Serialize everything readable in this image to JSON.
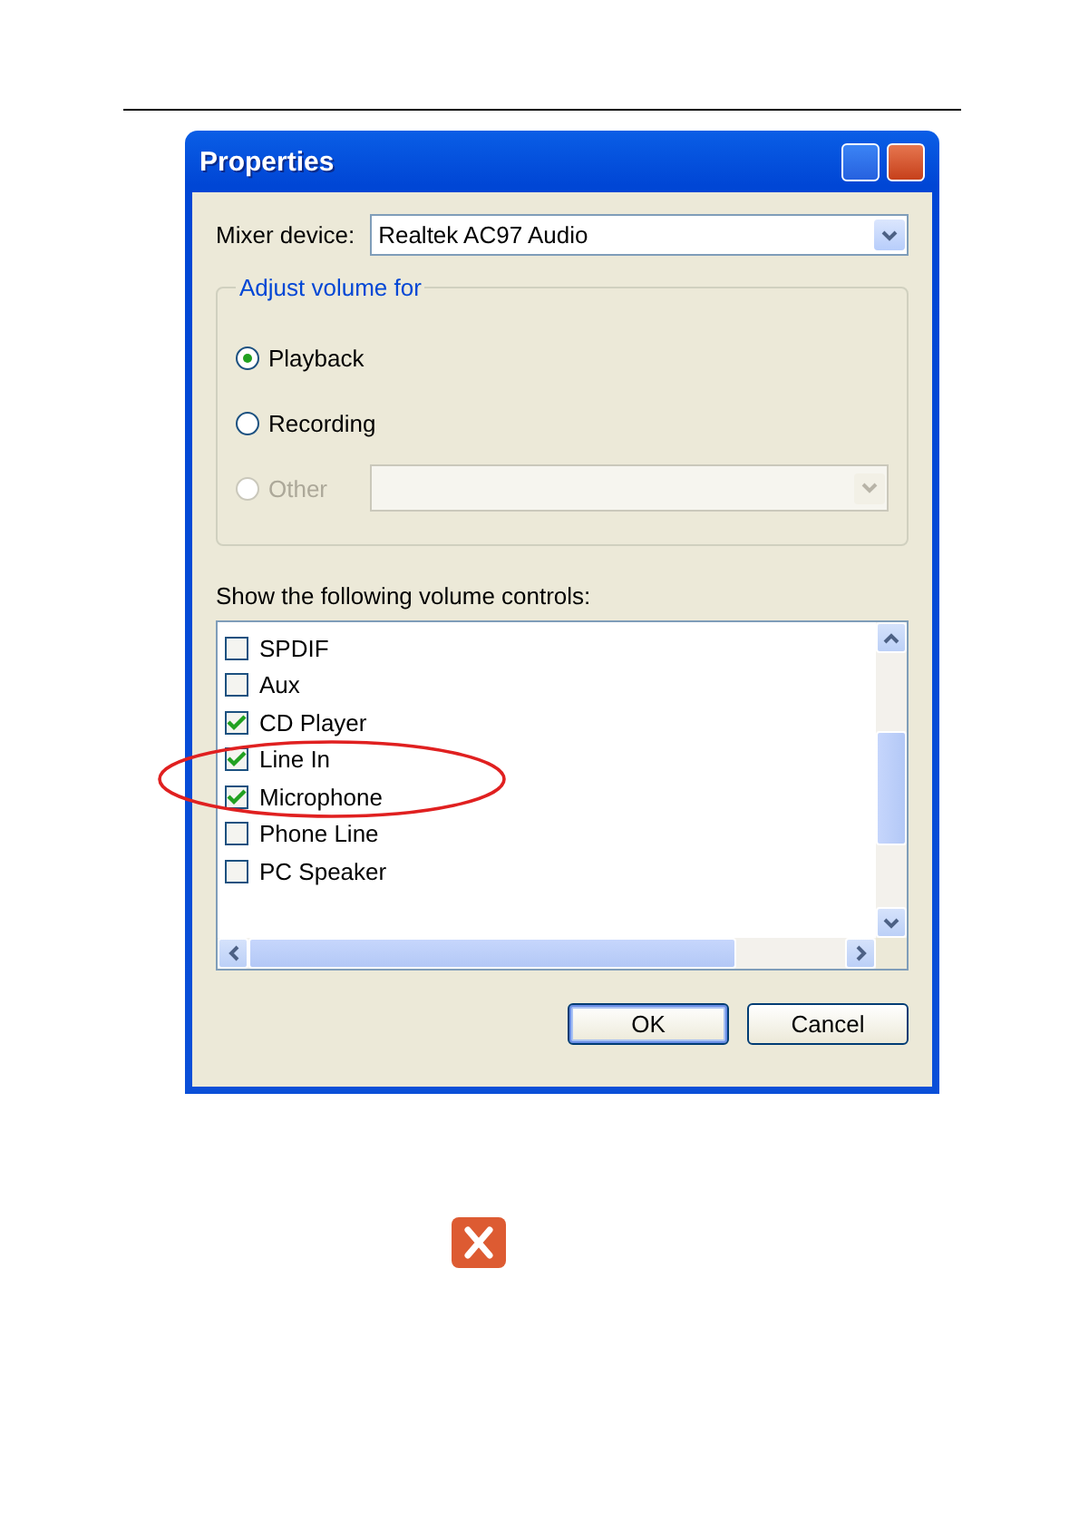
{
  "window": {
    "title": "Properties"
  },
  "mixer": {
    "label": "Mixer device:",
    "value": "Realtek AC97 Audio"
  },
  "adjust_group": {
    "title": "Adjust volume for",
    "options": [
      {
        "label": "Playback",
        "selected": true,
        "disabled": false
      },
      {
        "label": "Recording",
        "selected": false,
        "disabled": false
      },
      {
        "label": "Other",
        "selected": false,
        "disabled": true
      }
    ]
  },
  "controls_label": "Show the following volume controls:",
  "controls": [
    {
      "label": "SPDIF",
      "checked": false
    },
    {
      "label": "Aux",
      "checked": false
    },
    {
      "label": "CD Player",
      "checked": true
    },
    {
      "label": "Line In",
      "checked": true
    },
    {
      "label": "Microphone",
      "checked": true
    },
    {
      "label": "Phone Line",
      "checked": false
    },
    {
      "label": "PC Speaker",
      "checked": false
    }
  ],
  "buttons": [
    {
      "label": "OK",
      "default": true
    },
    {
      "label": "Cancel",
      "default": false
    }
  ]
}
